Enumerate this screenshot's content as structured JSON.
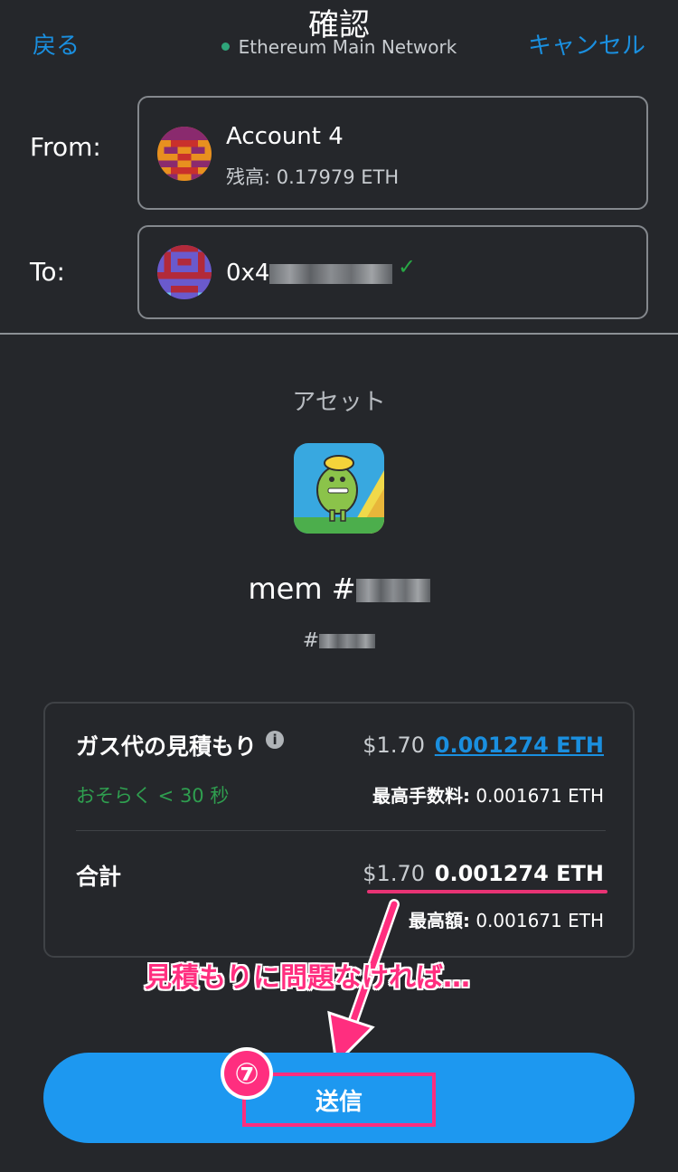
{
  "header": {
    "back_label": "戻る",
    "title": "確認",
    "network": "Ethereum Main Network",
    "cancel_label": "キャンセル",
    "network_dot_color": "#2fa57a"
  },
  "from": {
    "label": "From:",
    "account_name": "Account 4",
    "balance": "残高: 0.17979 ETH",
    "avatar_icon": "account-identicon"
  },
  "to": {
    "label": "To:",
    "address_prefix": "0x4",
    "verified_icon": "check-icon",
    "avatar_icon": "account-identicon"
  },
  "asset": {
    "label": "アセット",
    "nft_name_prefix": "mem #",
    "nft_id_prefix": "#",
    "image_icon": "nft-thumbnail"
  },
  "gas": {
    "title": "ガス代の見積もり",
    "info_icon": "i",
    "usd": "$1.70",
    "eth": "0.001274 ETH",
    "time_estimate": "おそらく < 30 秒",
    "max_fee_label": "最高手数料:",
    "max_fee_value": "0.001671 ETH"
  },
  "total": {
    "label": "合計",
    "usd": "$1.70",
    "eth": "0.001274 ETH",
    "max_label": "最高額:",
    "max_value": "0.001671 ETH"
  },
  "annotation": {
    "text": "見積もりに問題なければ…",
    "step_number": "⑦",
    "color": "#ff2e7f"
  },
  "actions": {
    "send_label": "送信",
    "button_color": "#1d98f0"
  }
}
